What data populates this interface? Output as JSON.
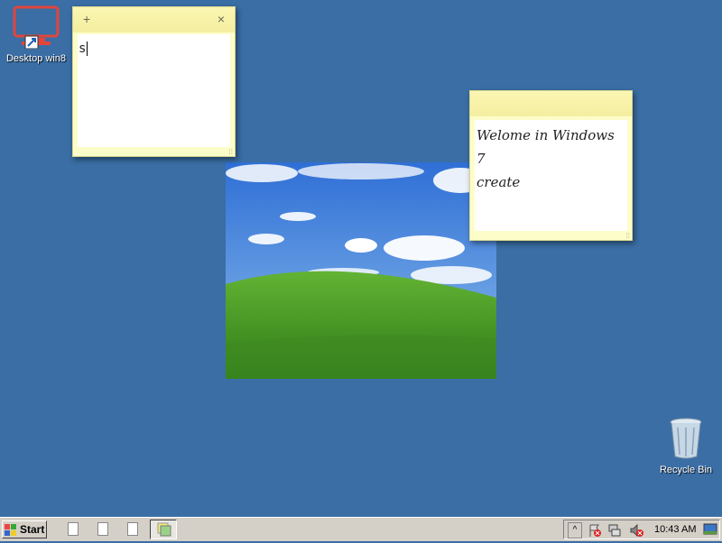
{
  "desktop": {
    "icons": [
      {
        "label": "Desktop win8",
        "icon": "remote-desktop-icon"
      },
      {
        "label": "Recycle Bin",
        "icon": "recycle-bin-icon"
      }
    ]
  },
  "notes": [
    {
      "new_btn": "+",
      "close_btn": "×",
      "text": "s"
    },
    {
      "text_line1": "Welome in Windows 7",
      "text_line2": "create"
    }
  ],
  "taskbar": {
    "start_label": "Start",
    "clock": "10:43 AM",
    "tray_icons": [
      "show-hidden-icons-chevron",
      "action-center-flag-icon",
      "network-icon",
      "volume-muted-icon",
      "show-desktop-icon"
    ]
  },
  "colors": {
    "desktop": "#3a6ea5",
    "note": "#fdfdc9",
    "taskbar": "#d4d0c8"
  }
}
